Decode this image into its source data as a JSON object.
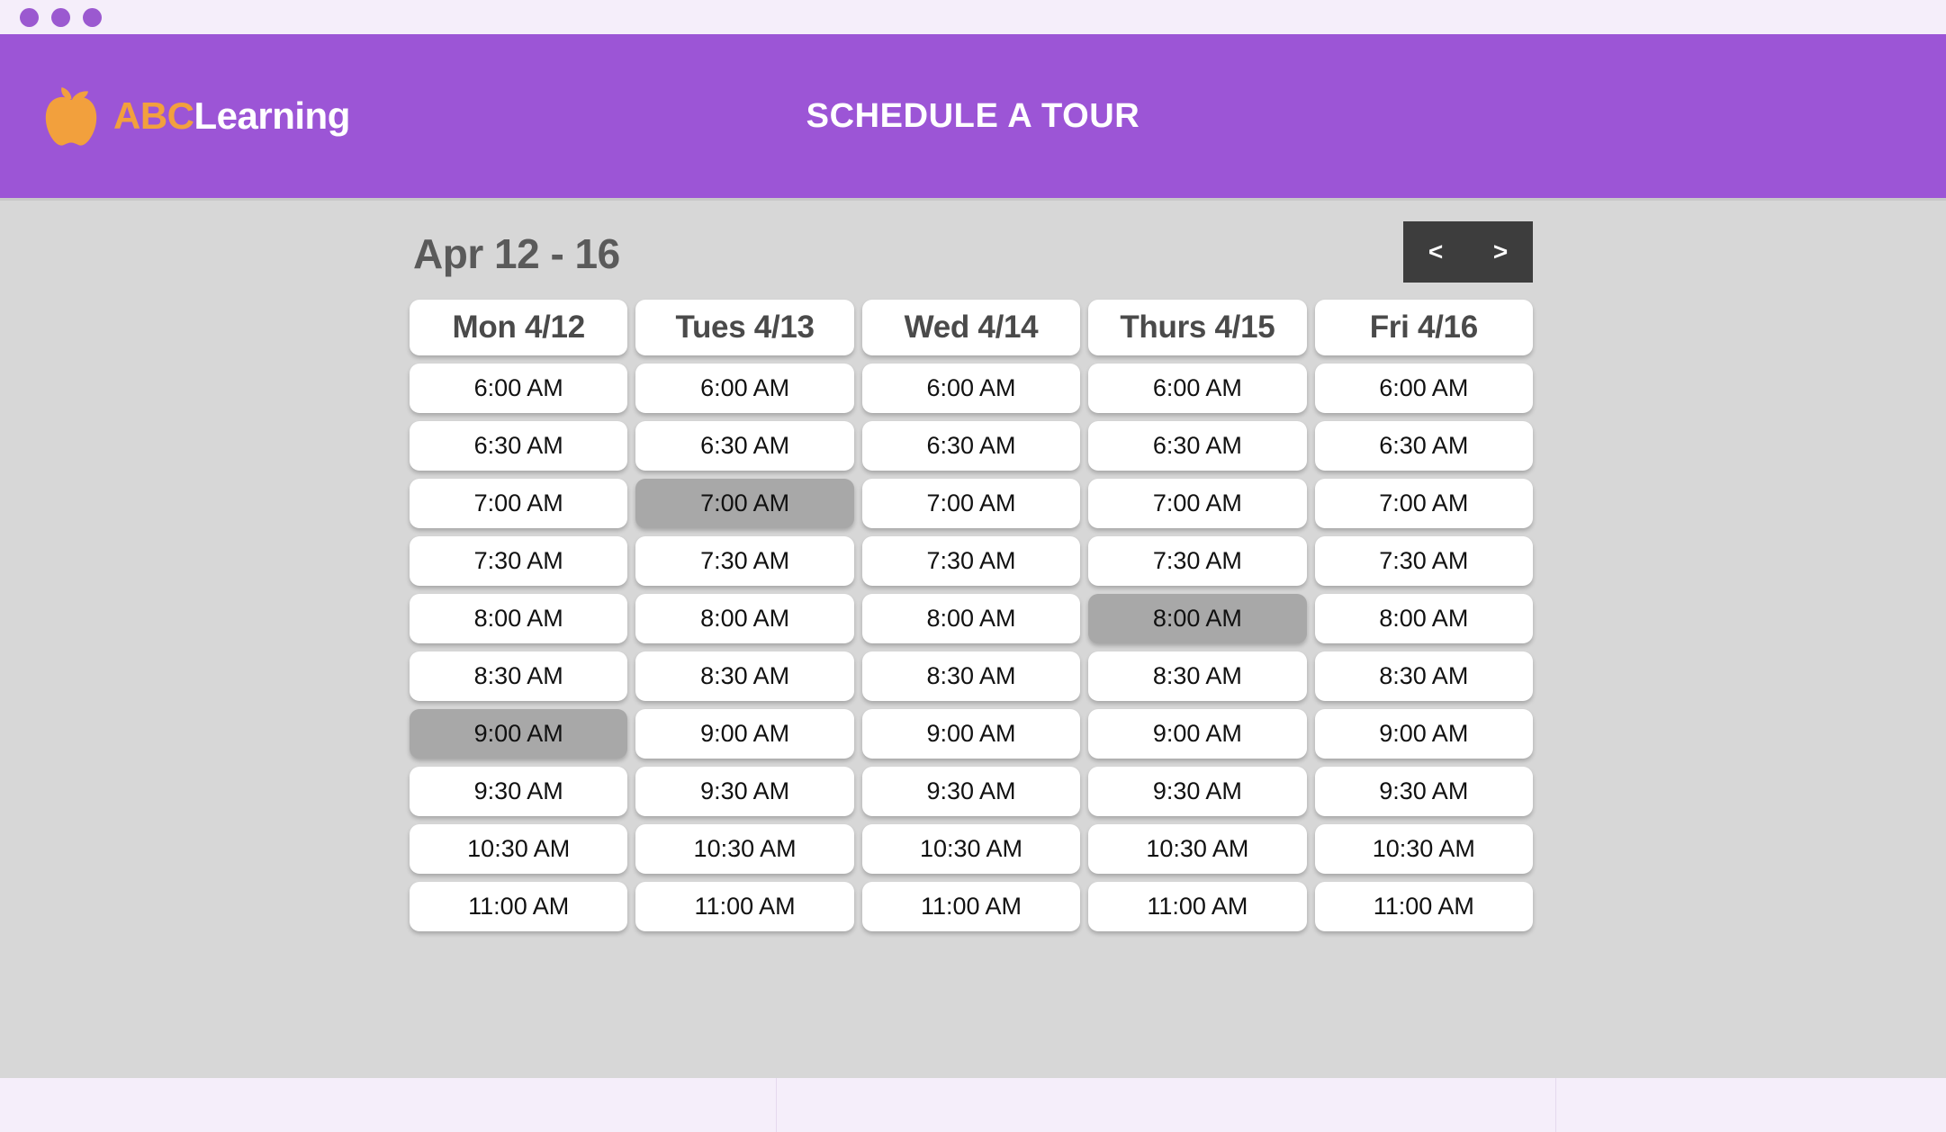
{
  "window": {
    "dots": [
      "dot-1",
      "dot-2",
      "dot-3"
    ]
  },
  "header": {
    "logo_icon": "apple-icon",
    "brand_prefix": "ABC",
    "brand_suffix": "Learning",
    "title": "SCHEDULE A TOUR",
    "background_color": "#9c55d6",
    "brand_prefix_color": "#f2a03d",
    "brand_suffix_color": "#ffffff"
  },
  "scheduler": {
    "range_title": "Apr 12 - 16",
    "nav": {
      "prev_label": "<",
      "next_label": ">",
      "background_color": "#3d3d3d"
    },
    "columns": [
      {
        "label": "Mon 4/12"
      },
      {
        "label": "Tues 4/13"
      },
      {
        "label": "Wed 4/14"
      },
      {
        "label": "Thurs 4/15"
      },
      {
        "label": "Fri 4/16"
      }
    ],
    "times": [
      "6:00 AM",
      "6:30 AM",
      "7:00 AM",
      "7:30 AM",
      "8:00 AM",
      "8:30 AM",
      "9:00 AM",
      "9:30 AM",
      "10:30 AM",
      "11:00 AM"
    ],
    "selected_color": "#a8a8a8",
    "slots": [
      [
        {
          "time": "6:00 AM",
          "selected": false
        },
        {
          "time": "6:00 AM",
          "selected": false
        },
        {
          "time": "6:00 AM",
          "selected": false
        },
        {
          "time": "6:00 AM",
          "selected": false
        },
        {
          "time": "6:00 AM",
          "selected": false
        }
      ],
      [
        {
          "time": "6:30 AM",
          "selected": false
        },
        {
          "time": "6:30 AM",
          "selected": false
        },
        {
          "time": "6:30 AM",
          "selected": false
        },
        {
          "time": "6:30 AM",
          "selected": false
        },
        {
          "time": "6:30 AM",
          "selected": false
        }
      ],
      [
        {
          "time": "7:00 AM",
          "selected": false
        },
        {
          "time": "7:00 AM",
          "selected": true
        },
        {
          "time": "7:00 AM",
          "selected": false
        },
        {
          "time": "7:00 AM",
          "selected": false
        },
        {
          "time": "7:00 AM",
          "selected": false
        }
      ],
      [
        {
          "time": "7:30 AM",
          "selected": false
        },
        {
          "time": "7:30 AM",
          "selected": false
        },
        {
          "time": "7:30 AM",
          "selected": false
        },
        {
          "time": "7:30 AM",
          "selected": false
        },
        {
          "time": "7:30 AM",
          "selected": false
        }
      ],
      [
        {
          "time": "8:00 AM",
          "selected": false
        },
        {
          "time": "8:00 AM",
          "selected": false
        },
        {
          "time": "8:00 AM",
          "selected": false
        },
        {
          "time": "8:00 AM",
          "selected": true
        },
        {
          "time": "8:00 AM",
          "selected": false
        }
      ],
      [
        {
          "time": "8:30 AM",
          "selected": false
        },
        {
          "time": "8:30 AM",
          "selected": false
        },
        {
          "time": "8:30 AM",
          "selected": false
        },
        {
          "time": "8:30 AM",
          "selected": false
        },
        {
          "time": "8:30 AM",
          "selected": false
        }
      ],
      [
        {
          "time": "9:00 AM",
          "selected": true
        },
        {
          "time": "9:00 AM",
          "selected": false
        },
        {
          "time": "9:00 AM",
          "selected": false
        },
        {
          "time": "9:00 AM",
          "selected": false
        },
        {
          "time": "9:00 AM",
          "selected": false
        }
      ],
      [
        {
          "time": "9:30 AM",
          "selected": false
        },
        {
          "time": "9:30 AM",
          "selected": false
        },
        {
          "time": "9:30 AM",
          "selected": false
        },
        {
          "time": "9:30 AM",
          "selected": false
        },
        {
          "time": "9:30 AM",
          "selected": false
        }
      ],
      [
        {
          "time": "10:30 AM",
          "selected": false
        },
        {
          "time": "10:30 AM",
          "selected": false
        },
        {
          "time": "10:30 AM",
          "selected": false
        },
        {
          "time": "10:30 AM",
          "selected": false
        },
        {
          "time": "10:30 AM",
          "selected": false
        }
      ],
      [
        {
          "time": "11:00 AM",
          "selected": false
        },
        {
          "time": "11:00 AM",
          "selected": false
        },
        {
          "time": "11:00 AM",
          "selected": false
        },
        {
          "time": "11:00 AM",
          "selected": false
        },
        {
          "time": "11:00 AM",
          "selected": false
        }
      ]
    ]
  },
  "footer": {
    "divider_positions": [
      862,
      1728
    ]
  }
}
